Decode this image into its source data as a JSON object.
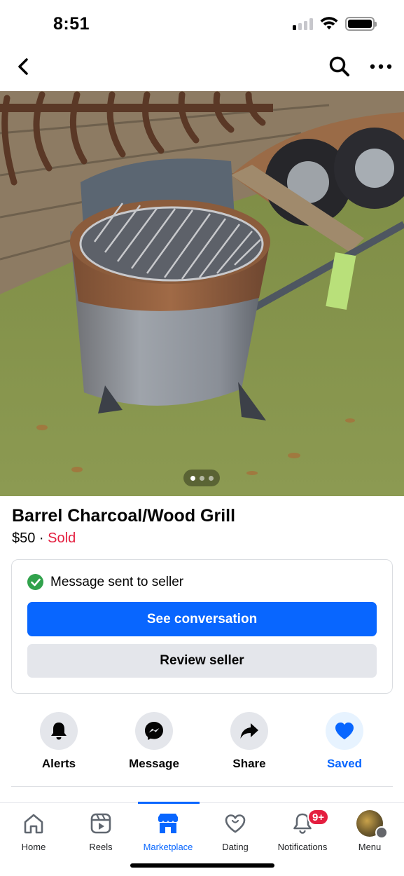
{
  "status_bar": {
    "time": "8:51"
  },
  "listing": {
    "title": "Barrel Charcoal/Wood Grill",
    "price": "$50",
    "separator": " · ",
    "status": "Sold",
    "photo_count": 3,
    "photo_index": 1
  },
  "message_card": {
    "status_text": "Message sent to seller",
    "primary_button": "See conversation",
    "secondary_button": "Review seller"
  },
  "actions": [
    {
      "label": "Alerts",
      "icon": "bell-icon"
    },
    {
      "label": "Message",
      "icon": "messenger-icon"
    },
    {
      "label": "Share",
      "icon": "share-arrow-icon"
    },
    {
      "label": "Saved",
      "icon": "heart-icon",
      "active": true
    }
  ],
  "tab_bar": {
    "tabs": [
      {
        "label": "Home",
        "icon": "home-icon"
      },
      {
        "label": "Reels",
        "icon": "reels-icon"
      },
      {
        "label": "Marketplace",
        "icon": "marketplace-icon",
        "active": true
      },
      {
        "label": "Dating",
        "icon": "dating-icon"
      },
      {
        "label": "Notifications",
        "icon": "bell-icon",
        "badge": "9+"
      },
      {
        "label": "Menu",
        "icon": "avatar"
      }
    ]
  },
  "colors": {
    "accent": "#0866ff",
    "sold": "#e41e3f",
    "success": "#31a24c",
    "badge": "#e41e3f"
  }
}
